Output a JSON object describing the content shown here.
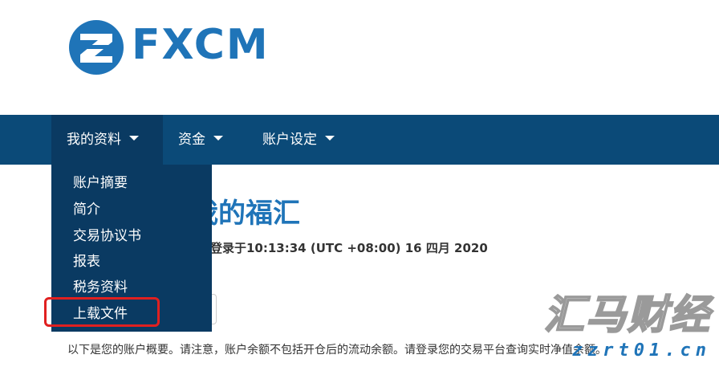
{
  "brand": {
    "name": "FXCM",
    "color": "#1f74b8"
  },
  "nav": {
    "items": [
      {
        "label": "我的资料"
      },
      {
        "label": "资金"
      },
      {
        "label": "账户设定"
      }
    ]
  },
  "dropdown": {
    "items": [
      {
        "label": "账户摘要"
      },
      {
        "label": "简介"
      },
      {
        "label": "交易协议书"
      },
      {
        "label": "报表"
      },
      {
        "label": "税务资料"
      },
      {
        "label": "上载文件",
        "highlighted": true
      }
    ]
  },
  "main": {
    "welcome": "我的福汇",
    "last_login": "登录于10:13:34 (UTC +08:00) 16 四月 2020",
    "summary": "以下是您的账户概要。请注意，账户余额不包括开仓后的流动余额。请登录您的交易平台查询实时净值余额。"
  },
  "watermark": {
    "main": "汇马财经",
    "sub": "zzrt01.cn"
  },
  "colors": {
    "nav_bg": "#0b4a78",
    "dropdown_bg": "#0a3a62",
    "highlight": "#e02020"
  }
}
